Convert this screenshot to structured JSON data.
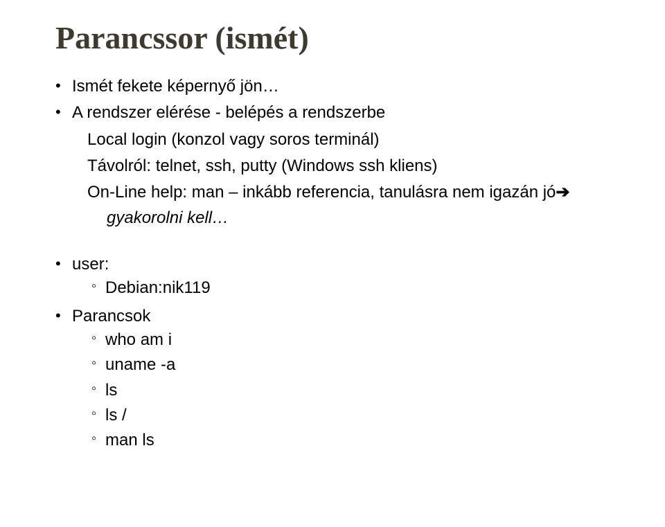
{
  "title": "Parancssor (ismét)",
  "bullets": {
    "b1": "Ismét fekete képernyő jön…",
    "b2": "A rendszer elérése  - belépés a rendszerbe",
    "sub1": "Local login (konzol vagy soros terminál)",
    "sub2": "Távolról: telnet, ssh, putty (Windows ssh kliens)",
    "sub3a": "On-Line help: man – inkább referencia, tanulásra nem igazán jó",
    "sub3b": "gyakorolni kell…",
    "user_label": "user:",
    "user_value": "Debian:nik119",
    "commands_label": "Parancsok",
    "cmds": {
      "c1": "who am i",
      "c2": "uname -a",
      "c3": "ls",
      "c4": "ls /",
      "c5": "man ls"
    }
  }
}
